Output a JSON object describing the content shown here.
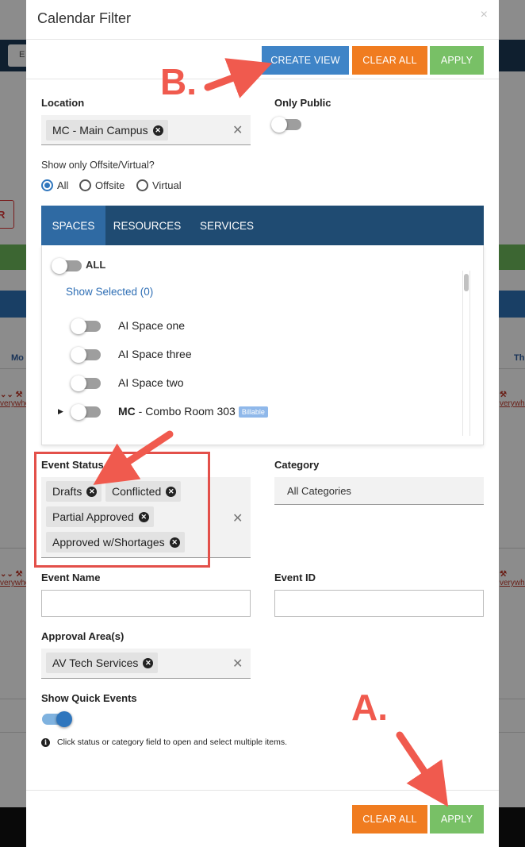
{
  "background": {
    "toolbar_input": "E",
    "red_button": "R",
    "day_left": "Mo",
    "day_right": "Th",
    "event_link": "verywhe",
    "colors": {
      "nav": "#1c3a57",
      "green": "#6dbb5b",
      "blue": "#2e73b8"
    }
  },
  "modal": {
    "title": "Calendar Filter",
    "close_icon": "×",
    "toolbar": {
      "create_view": "CREATE VIEW",
      "clear_all": "CLEAR ALL",
      "apply": "APPLY"
    },
    "location": {
      "label": "Location",
      "chips": [
        "MC - Main Campus"
      ]
    },
    "only_public": {
      "label": "Only Public",
      "on": false
    },
    "offsite": {
      "label": "Show only Offsite/Virtual?",
      "options": [
        "All",
        "Offsite",
        "Virtual"
      ],
      "selected": "All"
    },
    "tabs": [
      "SPACES",
      "RESOURCES",
      "SERVICES"
    ],
    "active_tab": "SPACES",
    "spaces": {
      "all_label": "ALL",
      "show_selected": "Show Selected (0)",
      "items": [
        {
          "prefix": "",
          "name": "AI Space one"
        },
        {
          "prefix": "",
          "name": "AI Space three"
        },
        {
          "prefix": "",
          "name": "AI Space two"
        },
        {
          "prefix": "MC",
          "name": " - Combo Room 303",
          "badge": "Billable",
          "expandable": true
        }
      ]
    },
    "event_status": {
      "label": "Event Status",
      "chips": [
        "Drafts",
        "Conflicted",
        "Partial Approved",
        "Approved w/Shortages"
      ]
    },
    "category": {
      "label": "Category",
      "value": "All Categories"
    },
    "event_name": {
      "label": "Event Name",
      "value": ""
    },
    "event_id": {
      "label": "Event ID",
      "value": ""
    },
    "approval_areas": {
      "label": "Approval Area(s)",
      "chips": [
        "AV Tech Services"
      ]
    },
    "quick_events": {
      "label": "Show Quick Events",
      "on": true
    },
    "info": "Click status or category field to open and select multiple items.",
    "footer": {
      "clear_all": "CLEAR ALL",
      "apply": "APPLY"
    }
  },
  "annotations": {
    "a": "A.",
    "b": "B.",
    "color": "#f05a4e"
  }
}
